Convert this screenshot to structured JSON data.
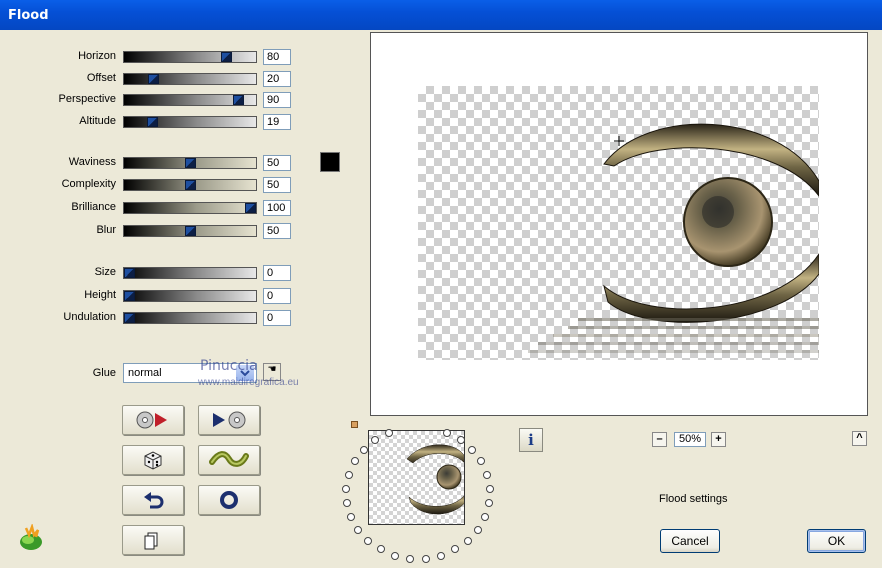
{
  "window": {
    "title": "Flood"
  },
  "sliders": [
    {
      "label": "Horizon",
      "value": "80",
      "level": 80
    },
    {
      "label": "Offset",
      "value": "20",
      "level": 20
    },
    {
      "label": "Perspective",
      "value": "90",
      "level": 90
    },
    {
      "label": "Altitude",
      "value": "19",
      "level": 19
    },
    {
      "label": "Waviness",
      "value": "50",
      "level": 50
    },
    {
      "label": "Complexity",
      "value": "50",
      "level": 50
    },
    {
      "label": "Brilliance",
      "value": "100",
      "level": 100
    },
    {
      "label": "Blur",
      "value": "50",
      "level": 50
    },
    {
      "label": "Size",
      "value": "0",
      "level": 0
    },
    {
      "label": "Height",
      "value": "0",
      "level": 0
    },
    {
      "label": "Undulation",
      "value": "0",
      "level": 0
    }
  ],
  "glue": {
    "label": "Glue",
    "value": "normal"
  },
  "watermark": {
    "line1": "Pinuccia",
    "line2": "www.maidiregrafica.eu"
  },
  "zoom": {
    "value": "50%",
    "minus": "–",
    "plus": "+",
    "up": "^"
  },
  "info_label": "i",
  "status_text": "Flood settings",
  "buttons": {
    "cancel": "Cancel",
    "ok": "OK"
  },
  "colors": {
    "titlebar": "#0550d6",
    "swatch": "#000000"
  }
}
